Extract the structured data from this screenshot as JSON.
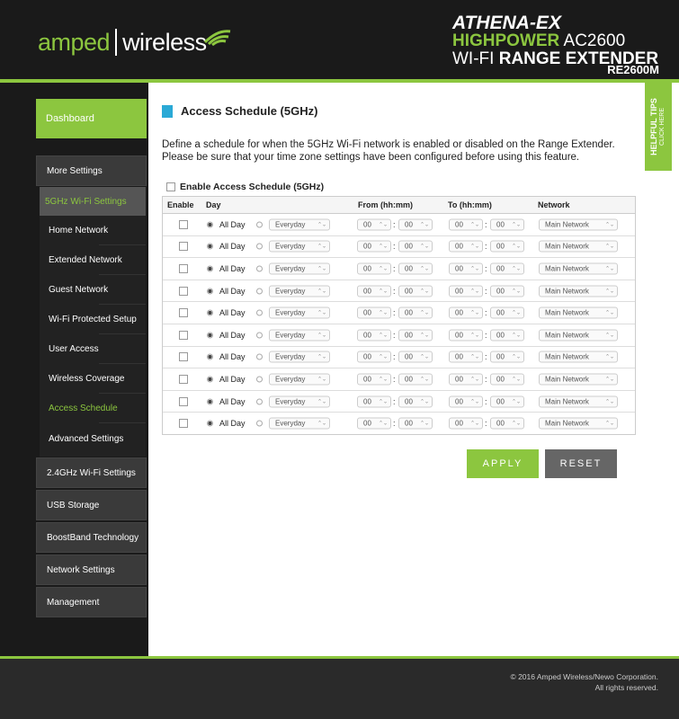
{
  "header": {
    "brand_a": "amped",
    "brand_b": "wireless",
    "line1": "ATHENA-EX",
    "line2_hp": "HIGHPOWER",
    "line2_ac": "AC2600",
    "line3_wifi": "WI-FI",
    "line3_rest": "RANGE EXTENDER",
    "model": "RE2600M",
    "brand_color": "#8cc63f"
  },
  "sidebar": {
    "dashboard": "Dashboard",
    "more_settings": "More Settings",
    "active_group": "5GHz Wi-Fi Settings",
    "sub_items": [
      "Home Network",
      "Extended Network",
      "Guest Network",
      "Wi-Fi Protected Setup",
      "User Access",
      "Wireless Coverage",
      "Access Schedule",
      "Advanced Settings"
    ],
    "groups": [
      "2.4GHz Wi-Fi Settings",
      "USB Storage",
      "BoostBand Technology",
      "Network Settings",
      "Management"
    ]
  },
  "tips": {
    "title": "HELPFUL TIPS",
    "sub": "CLICK HERE"
  },
  "main": {
    "title": "Access Schedule (5GHz)",
    "desc": "Define a schedule for when the 5GHz Wi-Fi network is enabled or disabled on the Range Extender. Please be sure that your time zone settings have been configured before using this feature.",
    "enable_all_label": "Enable Access Schedule (5GHz)",
    "columns": [
      "Enable",
      "Day",
      "From (hh:mm)",
      "To (hh:mm)",
      "Network"
    ],
    "row": {
      "all_day": "All Day",
      "day": "Everyday",
      "from_h": "00",
      "from_m": "00",
      "to_h": "00",
      "to_m": "00",
      "network": "Main Network"
    },
    "row_count": 10,
    "apply": "APPLY",
    "reset": "RESET"
  },
  "footer": {
    "line1": "© 2016 Amped Wireless/Newo Corporation.",
    "line2": "All rights reserved."
  }
}
